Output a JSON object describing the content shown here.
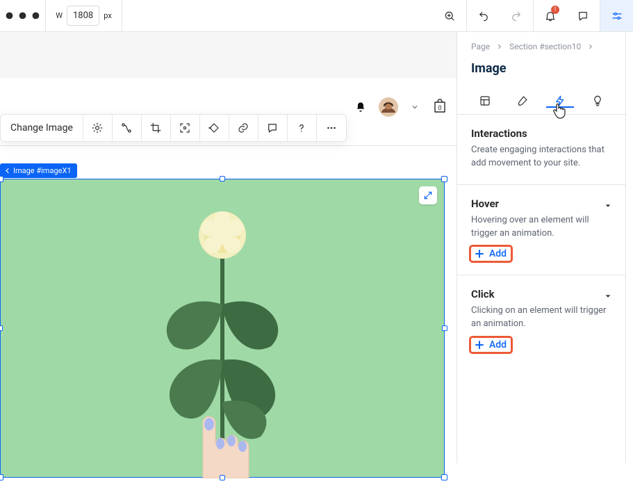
{
  "topbar": {
    "width_label": "W",
    "width_value": "1808",
    "width_unit": "px",
    "notification_badge": "!"
  },
  "floating_toolbar": {
    "change_image_label": "Change Image"
  },
  "stage": {
    "cart_badge": "0",
    "selection_tag": "Image #imageX1"
  },
  "panel": {
    "crumbs": [
      "Page",
      "Section #section10"
    ],
    "title": "Image",
    "interactions": {
      "heading": "Interactions",
      "desc": "Create engaging interactions that add movement to your site."
    },
    "hover": {
      "heading": "Hover",
      "desc": "Hovering over an element will trigger an animation.",
      "add_label": "Add"
    },
    "click": {
      "heading": "Click",
      "desc": "Clicking on an element will trigger an animation.",
      "add_label": "Add"
    }
  }
}
